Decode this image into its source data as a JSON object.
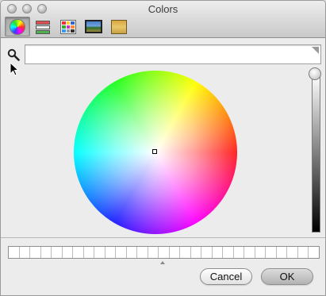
{
  "window": {
    "title": "Colors"
  },
  "toolbar": {
    "tabs": [
      {
        "icon": "color-wheel-icon",
        "selected": true
      },
      {
        "icon": "color-sliders-icon",
        "selected": false
      },
      {
        "icon": "color-palettes-icon",
        "selected": false
      },
      {
        "icon": "image-palettes-icon",
        "selected": false
      },
      {
        "icon": "crayons-icon",
        "selected": false
      }
    ]
  },
  "search": {
    "value": "",
    "placeholder": ""
  },
  "brightness": {
    "level": 1.0
  },
  "swatches": {
    "count": 29
  },
  "buttons": {
    "cancel_label": "Cancel",
    "ok_label": "OK"
  },
  "colors": {
    "wheel_center": "#ffffff",
    "window_bg": "#ececec"
  }
}
